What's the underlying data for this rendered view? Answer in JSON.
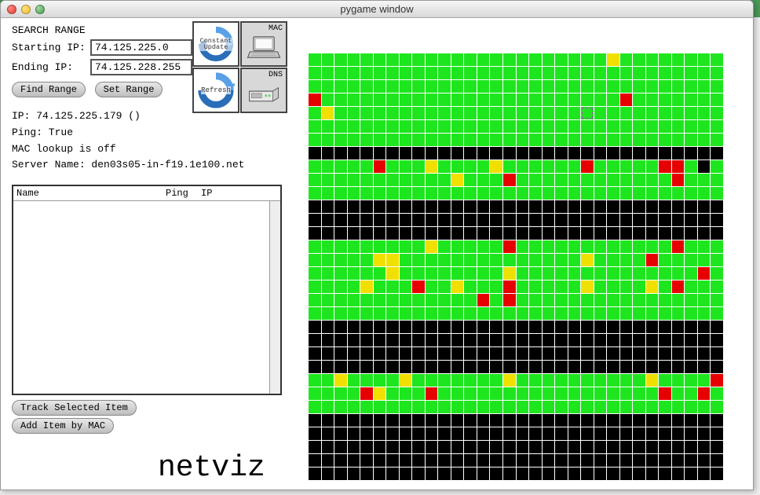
{
  "window": {
    "title": "pygame window"
  },
  "search": {
    "header": "SEARCH RANGE",
    "start_label": "Starting IP:",
    "start_value": "74.125.225.0",
    "end_label": "Ending IP:",
    "end_value": "74.125.228.255",
    "find_btn": "Find Range",
    "set_btn": "Set Range"
  },
  "info": {
    "ip_line": "IP: 74.125.225.179 ()",
    "ping_line": "Ping: True",
    "mac_line": "MAC lookup is off",
    "server_line": "Server Name: den03s05-in-f19.1e100.net"
  },
  "tools": {
    "constant_update": "Constant Update",
    "mac": "MAC",
    "refresh": "Refresh",
    "dns": "DNS"
  },
  "list": {
    "col_name": "Name",
    "col_ping": "Ping",
    "col_ip": "IP"
  },
  "bottom": {
    "track_btn": "Track Selected Item",
    "add_mac_btn": "Add Item by MAC"
  },
  "app_name": "netviz",
  "grid_rows": [
    "gggggggggggggggggggggggygggggggg",
    "gggggggggggggggggggggggggggggggg",
    "gggggggggggggggggggggggggggggggg",
    "rgggggggggggggggggggggggrggggggg",
    "gyggggggggggggggggggghgggggggggg",
    "gggggggggggggggggggggggggggggggg",
    "gggggggggggggggggggggggggggggggg",
    "kkkkkkkkkkkkkkkkkkkkkkkkkkkkkkkk",
    "gggggrgggyggggyggggggrgggggrrgkg",
    "gggggggggggygggrggggggggggggrggg",
    "gggggggggggggggggggggggggggggggg",
    "kkkkkkkkkkkkkkkkkkkkkkkkkkkkkkkk",
    "kkkkkkkkkkkkkkkkkkkkkkkkkkkkkkkk",
    "kkkkkkkkkkkkkkkkkkkkkkkkkkkkkkkk",
    "gggggggggygggggrggggggggggggrggg",
    "gggggyyggggggggggggggyggggrggggg",
    "ggggggyggggggggyggggggggggggggrg",
    "ggggygggrggygggrgggggyggggygrggg",
    "gggggggggggggrgrgggggggggggggggg",
    "gggggggggggggggggggggggggggggggg",
    "kkkkkkkkkkkkkkkkkkkkkkkkkkkkkkkk",
    "kkkkkkkkkkkkkkkkkkkkkkkkkkkkkkkk",
    "kkkkkkkkkkkkkkkkkkkkkkkkkkkkkkkk",
    "kkkkkkkkkkkkkkkkkkkkkkkkkkkkkkkk",
    "ggyggggygggggggyggggggggggyggggr",
    "ggggrygggrgggggggggggggggggrggrg",
    "gggggggggggggggggggggggggggggggg",
    "kkkkkkkkkkkkkkkkkkkkkkkkkkkkkkkk",
    "kkkkkkkkkkkkkkkkkkkkkkkkkkkkkkkk",
    "kkkkkkkkkkkkkkkkkkkkkkkkkkkkkkkk",
    "kkkkkkkkkkkkkkkkkkkkkkkkkkkkkkkk",
    "kkkkkkkkkkkkkkkkkkkkkkkkkkkkkkkk"
  ]
}
